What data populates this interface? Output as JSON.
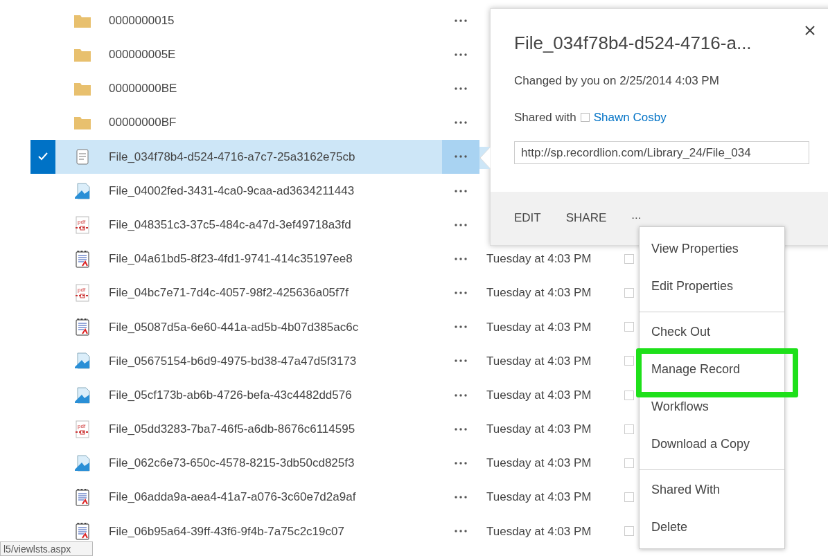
{
  "files": [
    {
      "kind": "folder",
      "name": "0000000015",
      "selected": false
    },
    {
      "kind": "folder",
      "name": "000000005E",
      "selected": false
    },
    {
      "kind": "folder",
      "name": "00000000BE",
      "selected": false
    },
    {
      "kind": "folder",
      "name": "00000000BF",
      "selected": false
    },
    {
      "kind": "note",
      "name": "File_034f78b4-d524-4716-a7c7-25a3162e75cb",
      "selected": true
    },
    {
      "kind": "image",
      "name": "File_04002fed-3431-4ca0-9caa-ad3634211443",
      "selected": false
    },
    {
      "kind": "pdf",
      "name": "File_048351c3-37c5-484c-a47d-3ef49718a3fd",
      "selected": false
    },
    {
      "kind": "doc",
      "name": "File_04a61bd5-8f23-4fd1-9741-414c35197ee8",
      "date": "Tuesday at 4:03 PM",
      "checked": false,
      "selected": false
    },
    {
      "kind": "pdf",
      "name": "File_04bc7e71-7d4c-4057-98f2-425636a05f7f",
      "date": "Tuesday at 4:03 PM",
      "checked": false,
      "selected": false
    },
    {
      "kind": "doc",
      "name": "File_05087d5a-6e60-441a-ad5b-4b07d385ac6c",
      "date": "Tuesday at 4:03 PM",
      "checked": false,
      "selected": false
    },
    {
      "kind": "image",
      "name": "File_05675154-b6d9-4975-bd38-47a47d5f3173",
      "date": "Tuesday at 4:03 PM",
      "checked": false,
      "selected": false
    },
    {
      "kind": "image",
      "name": "File_05cf173b-ab6b-4726-befa-43c4482dd576",
      "date": "Tuesday at 4:03 PM",
      "checked": false,
      "selected": false
    },
    {
      "kind": "pdf",
      "name": "File_05dd3283-7ba7-46f5-a6db-8676c6114595",
      "date": "Tuesday at 4:03 PM",
      "checked": false,
      "selected": false
    },
    {
      "kind": "image",
      "name": "File_062c6e73-650c-4578-8215-3db50cd825f3",
      "date": "Tuesday at 4:03 PM",
      "checked": false,
      "selected": false
    },
    {
      "kind": "doc",
      "name": "File_06adda9a-aea4-41a7-a076-3c60e7d2a9af",
      "date": "Tuesday at 4:03 PM",
      "checked": false,
      "selected": false
    },
    {
      "kind": "doc",
      "name": "File_06b95a64-39ff-43f6-9f4b-7a75c2c19c07",
      "date": "Tuesday at 4:03 PM",
      "checked": false,
      "selected": false
    }
  ],
  "callout": {
    "title": "File_034f78b4-d524-4716-a...",
    "changed": "Changed by you on 2/25/2014 4:03 PM",
    "shared_label": "Shared with",
    "presence_checked": false,
    "shared_user": "Shawn Cosby",
    "url": "http://sp.recordlion.com/Library_24/File_034",
    "actions": [
      "EDIT",
      "SHARE"
    ],
    "more": "..."
  },
  "menu": [
    {
      "label": "View Properties",
      "divider_after": false,
      "highlighted": false
    },
    {
      "label": "Edit Properties",
      "divider_after": true,
      "highlighted": false
    },
    {
      "label": "Check Out",
      "divider_after": false,
      "highlighted": false
    },
    {
      "label": "Manage Record",
      "divider_after": false,
      "highlighted": true
    },
    {
      "label": "Workflows",
      "divider_after": false,
      "highlighted": false
    },
    {
      "label": "Download a Copy",
      "divider_after": true,
      "highlighted": false
    },
    {
      "label": "Shared With",
      "divider_after": false,
      "highlighted": false
    },
    {
      "label": "Delete",
      "divider_after": false,
      "highlighted": false
    }
  ],
  "status_url": "l5/viewlsts.aspx"
}
